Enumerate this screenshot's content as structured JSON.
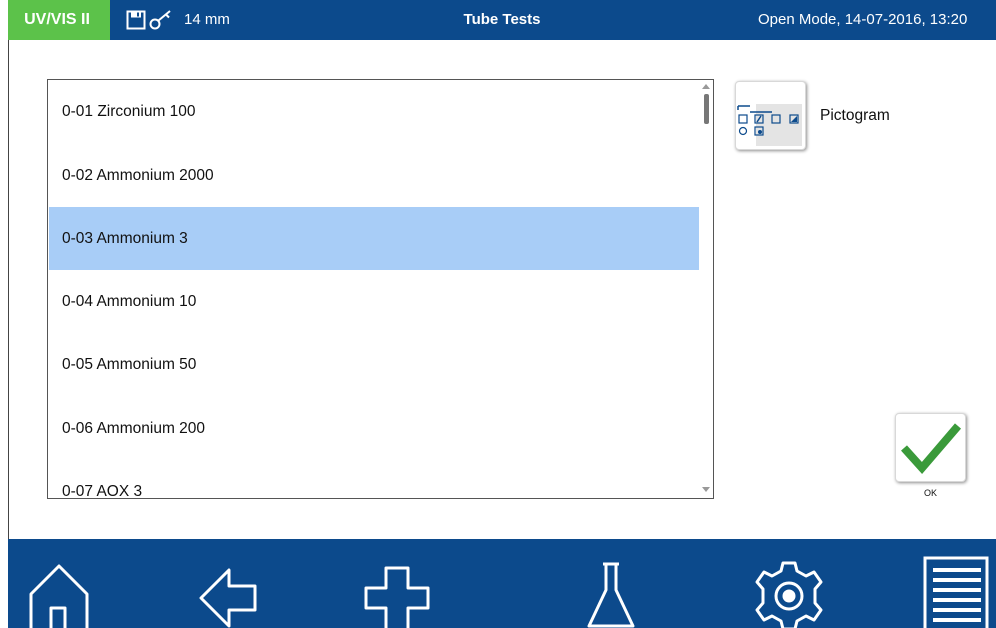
{
  "header": {
    "instrument": "UV/VIS II",
    "cuvette": "14 mm",
    "title": "Tube Tests",
    "status": "Open Mode, 14-07-2016, 13:20"
  },
  "tests": {
    "selected_index": 2,
    "items": [
      "0-01 Zirconium 100",
      "0-02 Ammonium 2000",
      "0-03 Ammonium 3",
      "0-04 Ammonium 10",
      "0-05 Ammonium 50",
      "0-06 Ammonium 200",
      "0-07 AOX 3"
    ]
  },
  "pictogram": {
    "label": "Pictogram",
    "icon": "pictogram-icon"
  },
  "ok": {
    "label": "OK",
    "icon": "checkmark-icon"
  },
  "nav": [
    {
      "icon": "home-icon"
    },
    {
      "icon": "back-arrow-icon"
    },
    {
      "icon": "add-icon"
    },
    {
      "icon": "flask-icon"
    },
    {
      "icon": "gear-icon"
    },
    {
      "icon": "list-icon"
    }
  ],
  "colors": {
    "header_blue": "#0c4a8c",
    "brand_green": "#5cc24a",
    "selection": "#a8cdf7",
    "check_green": "#3a9a3a"
  }
}
